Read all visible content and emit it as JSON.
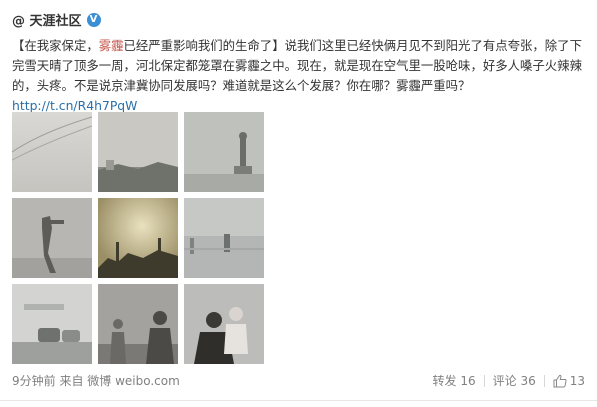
{
  "post": {
    "author": "@ 天涯社区",
    "verified_mark": "V",
    "text_part1": "【在我家保定，",
    "text_highlight": "雾霾",
    "text_part2": "已经严重影响我们的生命了】说我们这里已经快俩月见不到阳光了有点夸张，除了下完雪天晴了顶多一周，河北保定都笼罩在雾霾之中。现在，就是现在空气里一股呛味，好多人嗓子火辣辣的，头疼。不是说京津冀协同发展吗？难道就是这么个发展？你在哪？雾霾严重吗？",
    "link_text": "http://t.cn/R4h7PqW",
    "images": [
      {
        "icon": "smog-photo-1"
      },
      {
        "icon": "smog-photo-2"
      },
      {
        "icon": "smog-photo-3"
      },
      {
        "icon": "smog-photo-4"
      },
      {
        "icon": "smog-photo-5"
      },
      {
        "icon": "smog-photo-6"
      },
      {
        "icon": "smog-photo-7"
      },
      {
        "icon": "smog-photo-8"
      },
      {
        "icon": "smog-photo-9"
      }
    ]
  },
  "footer": {
    "time_source": "9分钟前 来自 微博 weibo.com",
    "repost_label": "转发 16",
    "comment_label": "评论 36",
    "like_count": "13"
  },
  "colors": {
    "highlight": "#c4574e",
    "link": "#2a6fa8",
    "badge": "#3b8fd6"
  }
}
